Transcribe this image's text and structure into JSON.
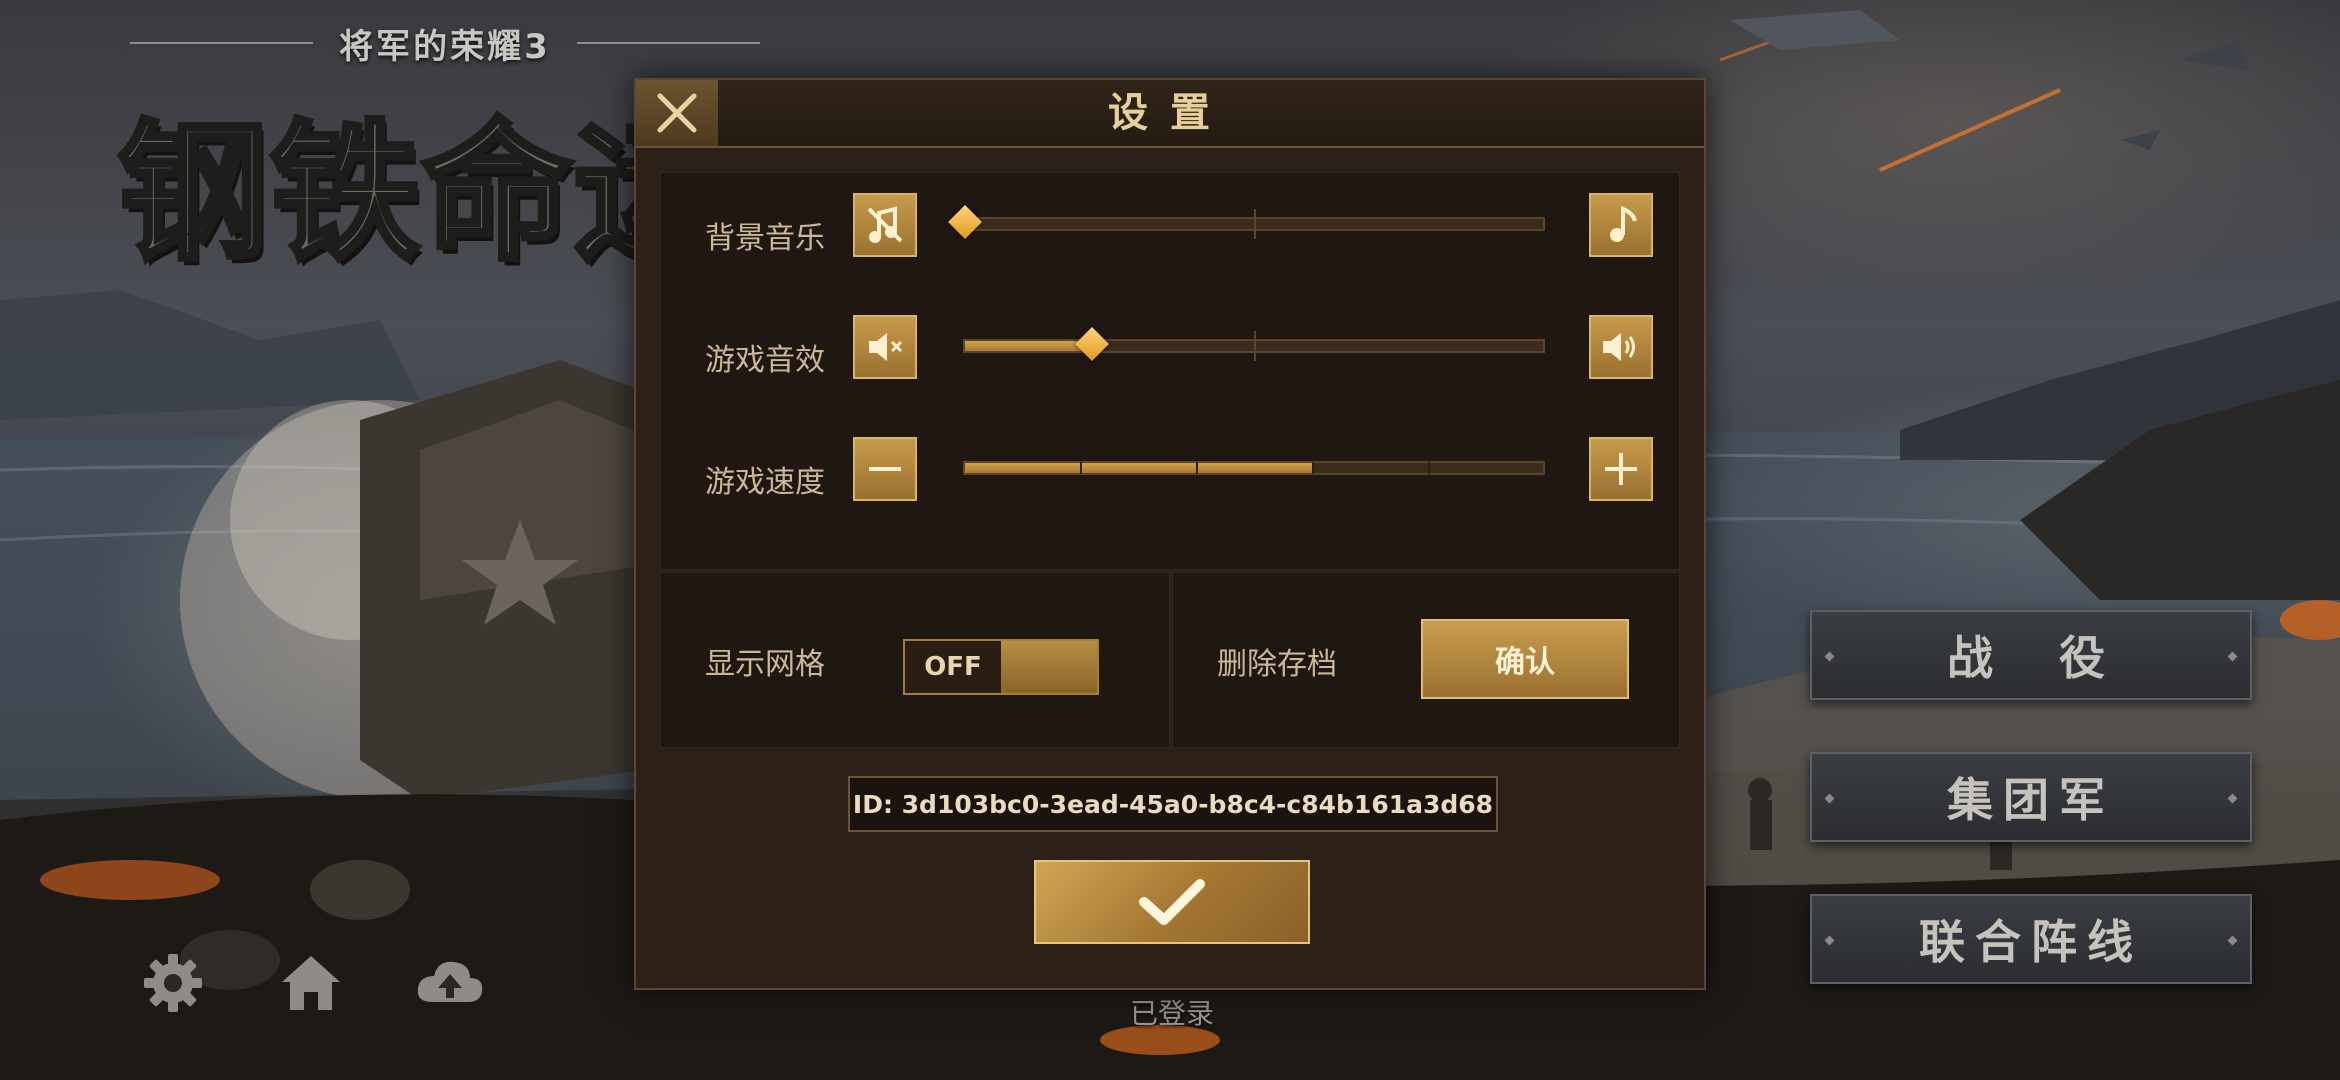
{
  "game": {
    "subtitle": "将军的荣耀3",
    "title": "钢铁命运"
  },
  "bottom_bar": {
    "icons": [
      "gear-icon",
      "home-icon",
      "cloud-upload-icon"
    ],
    "login_status": "已登录"
  },
  "modes": [
    {
      "label": "战　役"
    },
    {
      "label": "集团军"
    },
    {
      "label": "联合阵线"
    }
  ],
  "settings": {
    "title": "设置",
    "close_icon": "close-icon",
    "bgm": {
      "label": "背景音乐",
      "level": 0.0,
      "min_icon": "music-off-icon",
      "max_icon": "music-note-icon"
    },
    "sfx": {
      "label": "游戏音效",
      "level": 0.22,
      "min_icon": "speaker-mute-icon",
      "max_icon": "speaker-loud-icon"
    },
    "speed": {
      "label": "游戏速度",
      "level": 0.6,
      "segments": 5,
      "min_icon": "minus-icon",
      "max_icon": "plus-icon"
    },
    "grid": {
      "label": "显示网格",
      "toggle_text": "OFF",
      "state": false
    },
    "delete_save": {
      "label": "删除存档",
      "button": "确认"
    },
    "player_id": "ID: 3d103bc0-3ead-45a0-b8c4-c84b161a3d68",
    "ok_icon": "checkmark-icon"
  },
  "colors": {
    "accent_gold": "#c79b4b",
    "dialog_bg": "#2b2119",
    "title_gold": "#e8cf98"
  }
}
